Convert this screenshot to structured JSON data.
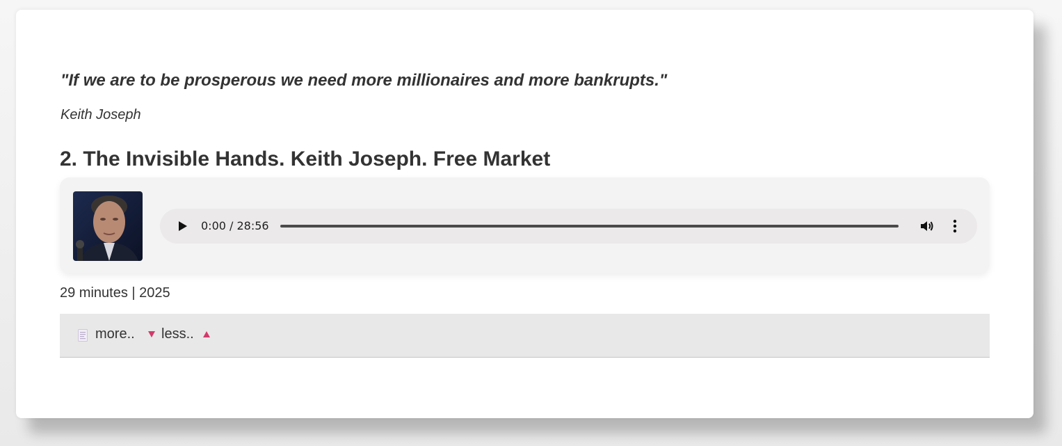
{
  "quote": {
    "text": "\"If we are to be prosperous we need more millionaires and more bankrupts.\"",
    "author": "Keith Joseph"
  },
  "episode": {
    "title": "2. The Invisible Hands. Keith Joseph. Free Market",
    "meta": "29 minutes | 2025"
  },
  "player": {
    "time_display": "0:00 / 28:56",
    "progress": 0,
    "icons": {
      "play": "play-icon",
      "volume": "volume-icon",
      "menu": "more-vertical-icon"
    }
  },
  "details": {
    "more_label": "more..",
    "less_label": "less..",
    "accent_color": "#d23a6b",
    "icons": {
      "document": "document-icon",
      "expand": "caret-down-icon",
      "collapse": "caret-up-icon"
    }
  }
}
